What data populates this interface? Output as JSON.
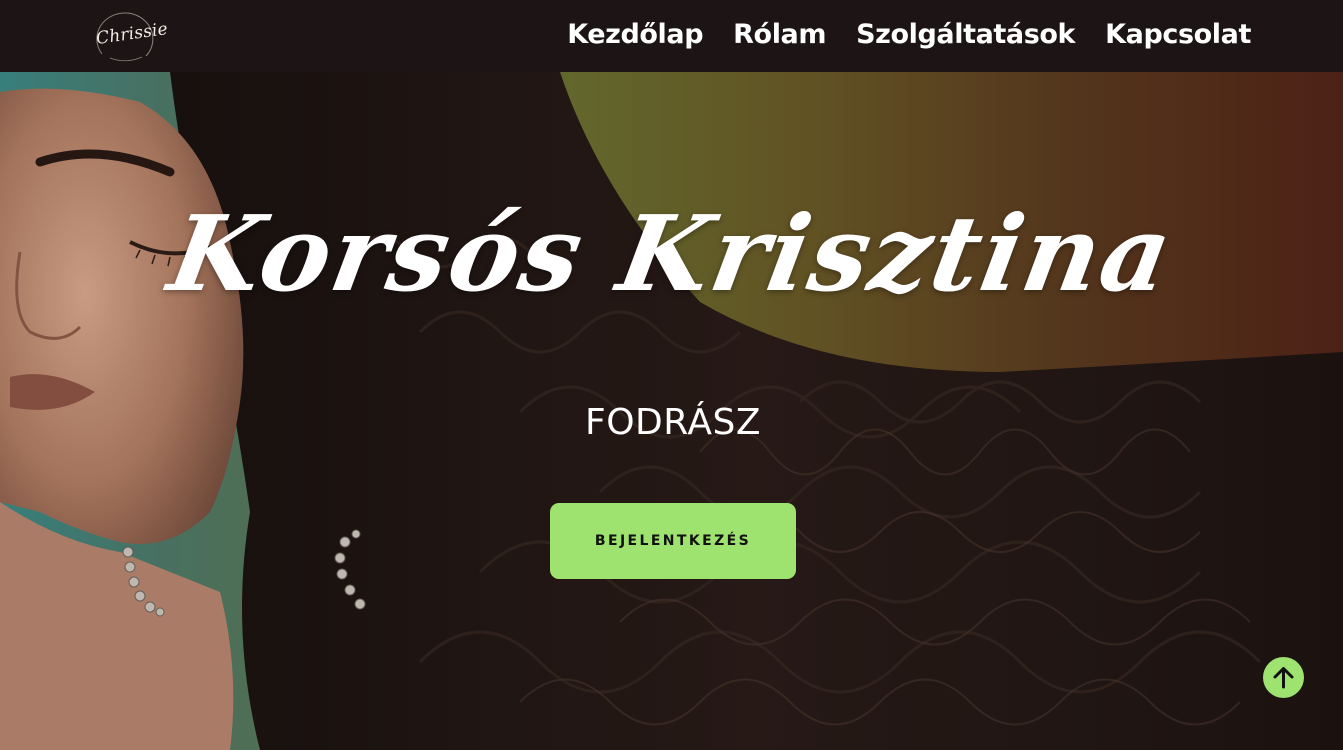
{
  "navbar": {
    "logo_text": "Chrissie",
    "links": [
      {
        "label": "Kezdőlap"
      },
      {
        "label": "Rólam"
      },
      {
        "label": "Szolgáltatások"
      },
      {
        "label": "Kapcsolat"
      }
    ]
  },
  "hero": {
    "title": "Korsós Krisztina",
    "subtitle": "FODRÁSZ",
    "cta_label": "BEJELENTKEZÉS",
    "scroll_top_icon": "arrow-up-icon"
  },
  "colors": {
    "accent": "#9ee270",
    "navbar_bg": "#1d1515",
    "text": "#ffffff"
  }
}
